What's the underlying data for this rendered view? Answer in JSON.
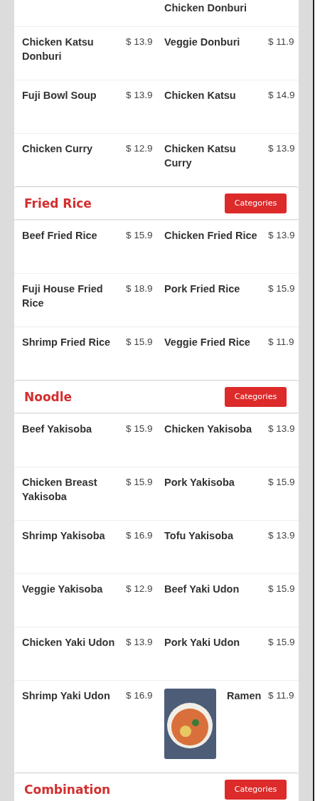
{
  "partial_row": {
    "right_name": "Chicken Donburi"
  },
  "sections": [
    {
      "items": [
        {
          "name": "Chicken Katsu Donburi",
          "price": "$ 13.9"
        },
        {
          "name": "Veggie Donburi",
          "price": "$ 11.9"
        },
        {
          "name": "Fuji Bowl Soup",
          "price": "$ 13.9"
        },
        {
          "name": "Chicken Katsu",
          "price": "$ 14.9"
        },
        {
          "name": "Chicken Curry",
          "price": "$ 12.9"
        },
        {
          "name": "Chicken Katsu Curry",
          "price": "$ 13.9"
        }
      ]
    },
    {
      "title": "Fried Rice",
      "button": "Categories",
      "items": [
        {
          "name": "Beef Fried Rice",
          "price": "$ 15.9"
        },
        {
          "name": "Chicken Fried Rice",
          "price": "$ 13.9"
        },
        {
          "name": "Fuji House Fried Rice",
          "price": "$ 18.9"
        },
        {
          "name": "Pork Fried Rice",
          "price": "$ 15.9"
        },
        {
          "name": "Shrimp Fried Rice",
          "price": "$ 15.9"
        },
        {
          "name": "Veggie Fried Rice",
          "price": "$ 11.9"
        }
      ]
    },
    {
      "title": "Noodle",
      "button": "Categories",
      "items": [
        {
          "name": "Beef Yakisoba",
          "price": "$ 15.9"
        },
        {
          "name": "Chicken Yakisoba",
          "price": "$ 13.9"
        },
        {
          "name": "Chicken Breast Yakisoba",
          "price": "$ 15.9"
        },
        {
          "name": "Pork Yakisoba",
          "price": "$ 15.9"
        },
        {
          "name": "Shrimp Yakisoba",
          "price": "$ 16.9"
        },
        {
          "name": "Tofu Yakisoba",
          "price": "$ 13.9"
        },
        {
          "name": "Veggie Yakisoba",
          "price": "$ 12.9"
        },
        {
          "name": "Beef Yaki Udon",
          "price": "$ 15.9"
        },
        {
          "name": "Chicken Yaki Udon",
          "price": "$ 13.9"
        },
        {
          "name": "Pork Yaki Udon",
          "price": "$ 15.9"
        },
        {
          "name": "Shrimp Yaki Udon",
          "price": "$ 16.9"
        },
        {
          "name": "Ramen",
          "price": "$ 11.9",
          "has_photo": true
        }
      ]
    },
    {
      "title": "Combination",
      "button": "Categories"
    }
  ]
}
